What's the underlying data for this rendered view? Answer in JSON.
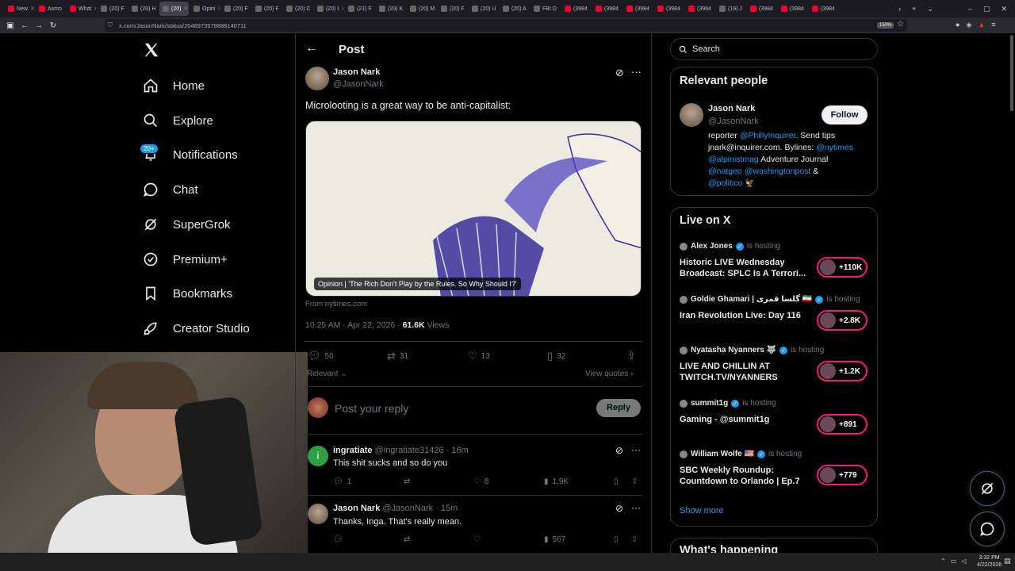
{
  "browser": {
    "tabs": [
      "New",
      "Asmo",
      "What",
      "(20) F",
      "(20) H",
      "(20)",
      "Opini",
      "(20) F",
      "(20) F",
      "(20) C",
      "(20) I",
      "(21) F",
      "(20) K",
      "(20) M",
      "(20) F",
      "(20) U",
      "(20) A",
      "FBI D",
      "(3984",
      "(3984",
      "(3984",
      "(3984",
      "(3984",
      "(19) J",
      "(3984",
      "(3984",
      "(3984"
    ],
    "url": "x.com/JasonNark/status/2046973579888140711",
    "zoom": "150%"
  },
  "sidebar": {
    "notif_badge": "20+",
    "items": [
      {
        "label": "Home",
        "icon": "home-icon"
      },
      {
        "label": "Explore",
        "icon": "search-icon"
      },
      {
        "label": "Notifications",
        "icon": "bell-icon"
      },
      {
        "label": "Chat",
        "icon": "chat-icon"
      },
      {
        "label": "SuperGrok",
        "icon": "grok-icon"
      },
      {
        "label": "Premium+",
        "icon": "verified-icon"
      },
      {
        "label": "Bookmarks",
        "icon": "bookmark-icon"
      },
      {
        "label": "Creator Studio",
        "icon": "rocket-icon"
      }
    ]
  },
  "post": {
    "header_title": "Post",
    "author_name": "Jason Nark",
    "author_handle": "@JasonNark",
    "text": "Microlooting is a great way to be anti-capitalist:",
    "card_caption": "Opinion | 'The Rich Don't Play by the Rules. So Why Should I?'",
    "card_source": "From nytimes.com",
    "timestamp": "10:25 AM · Apr 22, 2026 · ",
    "views_count": "61.6K",
    "views_label": "Views",
    "replies": "50",
    "reposts": "31",
    "likes": "13",
    "bookmarks": "32",
    "sort_label": "Relevant",
    "view_quotes": "View quotes",
    "reply_placeholder": "Post your reply",
    "reply_button": "Reply"
  },
  "replies": [
    {
      "name": "ingratiate",
      "handle": "@ingratiate31426",
      "time": "16m",
      "text": "This shit sucks and so do you",
      "replies": "1",
      "reposts": "",
      "likes": "8",
      "views": "1.9K",
      "avatar_letter": "i",
      "avatar_color": "#2ea043"
    },
    {
      "name": "Jason Nark",
      "handle": "@JasonNark",
      "time": "15m",
      "text": "Thanks, Inga. That's really mean.",
      "replies": "",
      "reposts": "",
      "likes": "",
      "views": "567"
    }
  ],
  "right": {
    "search_placeholder": "Search",
    "relevant_title": "Relevant people",
    "person": {
      "name": "Jason Nark",
      "handle": "@JasonNark",
      "follow": "Follow",
      "bio_1a": "reporter ",
      "bio_1b": "@PhillyInquirer",
      "bio_1c": ". Send tips",
      "bio_2a": "jnark@inquirer.com. Bylines: ",
      "bio_2b": "@nytimes",
      "bio_3a": "@alpinistmag",
      "bio_3b": " Adventure Journal",
      "bio_4a": "@natgeo",
      "bio_4b": " @washingtonpost",
      "bio_4c": " &",
      "bio_5a": "@politico",
      "bio_5b": " 🦅"
    },
    "live_title": "Live on X",
    "live": [
      {
        "host": "Alex Jones",
        "status": "is hosting",
        "title": "Historic LIVE Wednesday Broadcast: SPLC Is A Terrori...",
        "count": "+110K"
      },
      {
        "host": "Goldie Ghamari | گلسا قمری 🇮🇷",
        "status": "is hosting",
        "title": "Iran Revolution Live: Day 116",
        "count": "+2.8K"
      },
      {
        "host": "Nyatasha Nyanners 🐺",
        "status": "is hosting",
        "title": "LIVE AND CHILLIN AT TWITCH.TV/NYANNERS",
        "count": "+1.2K"
      },
      {
        "host": "summit1g",
        "status": "is hosting",
        "title": "Gaming - @summit1g",
        "count": "+891"
      },
      {
        "host": "William Wolfe 🇺🇸",
        "status": "is hosting",
        "title": "SBC Weekly Roundup: Countdown to Orlando | Ep.7",
        "count": "+779"
      }
    ],
    "show_more": "Show more",
    "whats_happening": "What's happening"
  },
  "taskbar": {
    "time": "3:32 PM",
    "date": "4/22/2026"
  },
  "colors": {
    "accent": "#1d9bf0",
    "live": "#f91880",
    "bg": "#000000"
  }
}
